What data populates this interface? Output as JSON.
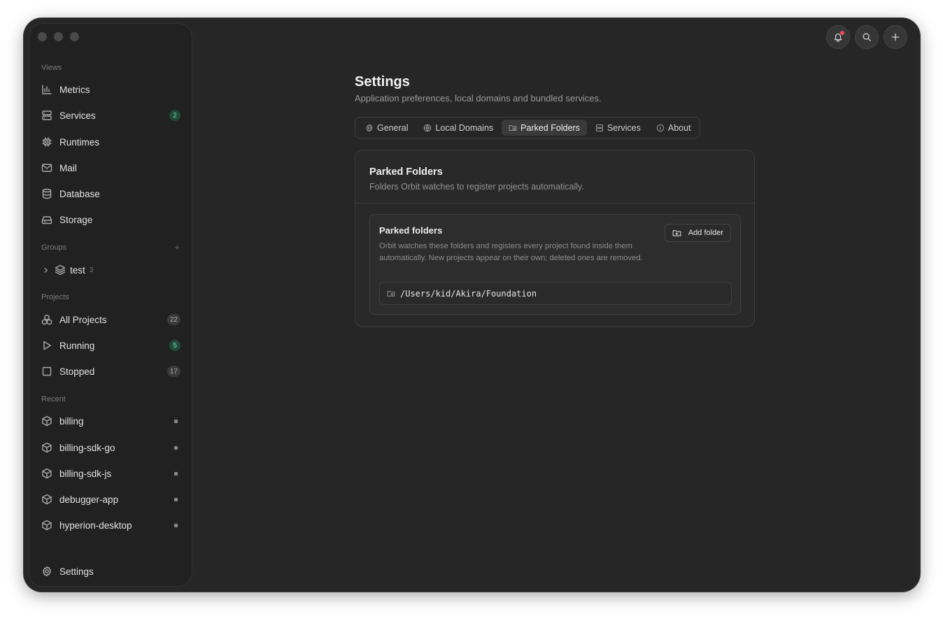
{
  "sidebar": {
    "views_title": "Views",
    "views": [
      {
        "label": "Metrics",
        "icon": "bar-chart-icon"
      },
      {
        "label": "Services",
        "icon": "server-icon",
        "badge": "2"
      },
      {
        "label": "Runtimes",
        "icon": "cpu-icon"
      },
      {
        "label": "Mail",
        "icon": "mail-icon"
      },
      {
        "label": "Database",
        "icon": "database-icon"
      },
      {
        "label": "Storage",
        "icon": "hard-drive-icon"
      }
    ],
    "groups_title": "Groups",
    "groups_add": "+",
    "groups": [
      {
        "label": "test",
        "count": "3",
        "icon": "layers-icon"
      }
    ],
    "projects_title": "Projects",
    "projects": [
      {
        "label": "All Projects",
        "badge": "22",
        "icon": "boxes-icon"
      },
      {
        "label": "Running",
        "badge": "5",
        "icon": "play-icon"
      },
      {
        "label": "Stopped",
        "badge": "17",
        "icon": "square-icon"
      }
    ],
    "recent_title": "Recent",
    "recent": [
      {
        "label": "billing"
      },
      {
        "label": "billing-sdk-go"
      },
      {
        "label": "billing-sdk-js"
      },
      {
        "label": "debugger-app"
      },
      {
        "label": "hyperion-desktop"
      }
    ],
    "settings_label": "Settings"
  },
  "header": {
    "title": "Settings",
    "subtitle": "Application preferences, local domains and bundled services."
  },
  "tabs": [
    {
      "label": "General",
      "icon": "gear-icon"
    },
    {
      "label": "Local Domains",
      "icon": "globe-icon"
    },
    {
      "label": "Parked Folders",
      "icon": "folder-search-icon",
      "active": true
    },
    {
      "label": "Services",
      "icon": "server-icon"
    },
    {
      "label": "About",
      "icon": "info-icon"
    }
  ],
  "card": {
    "title": "Parked Folders",
    "subtitle": "Folders Orbit watches to register projects automatically.",
    "section_title": "Parked folders",
    "section_desc": "Orbit watches these folders and registers every project found inside them automatically. New projects appear on their own; deleted ones are removed.",
    "add_label": "Add folder",
    "folders": [
      "/Users/kid/Akira/Foundation"
    ]
  },
  "colors": {
    "window_bg": "#262626",
    "sidebar_bg": "#212121",
    "badge_green": "#1f4a38",
    "notification": "#ee4a60"
  }
}
